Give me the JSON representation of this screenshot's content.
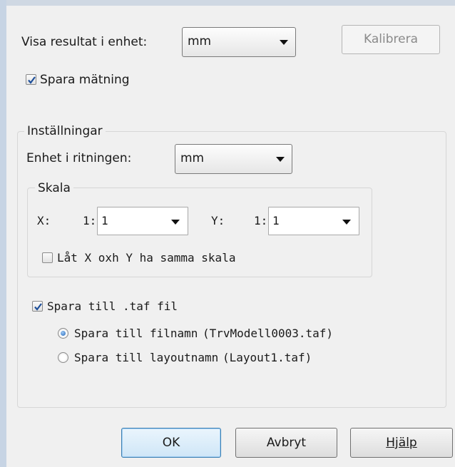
{
  "top": {
    "unit_label": "Visa resultat i enhet:",
    "unit_value": "mm",
    "calibrate_label": "Kalibrera",
    "save_measure_label": "Spara mätning",
    "save_measure_checked": true
  },
  "settings": {
    "legend": "Inställningar",
    "drawing_unit_label": "Enhet i ritningen:",
    "drawing_unit_value": "mm",
    "scale": {
      "legend": "Skala",
      "x_label": "X:",
      "x_prefix": "1:",
      "x_value": "1",
      "y_label": "Y:",
      "y_prefix": "1:",
      "y_value": "1",
      "same_scale_label": "Låt X oxh Y ha samma skala",
      "same_scale_checked": false
    },
    "save_taf_label": "Spara till .taf fil",
    "save_taf_checked": true,
    "radio_filename_label": "Spara till filnamn",
    "radio_filename_file": "(TrvModell0003.taf)",
    "radio_layout_label": "Spara till layoutnamn",
    "radio_layout_file": "(Layout1.taf)",
    "selected_radio": "filename"
  },
  "buttons": {
    "ok": "OK",
    "cancel": "Avbryt",
    "help": "Hjälp"
  }
}
